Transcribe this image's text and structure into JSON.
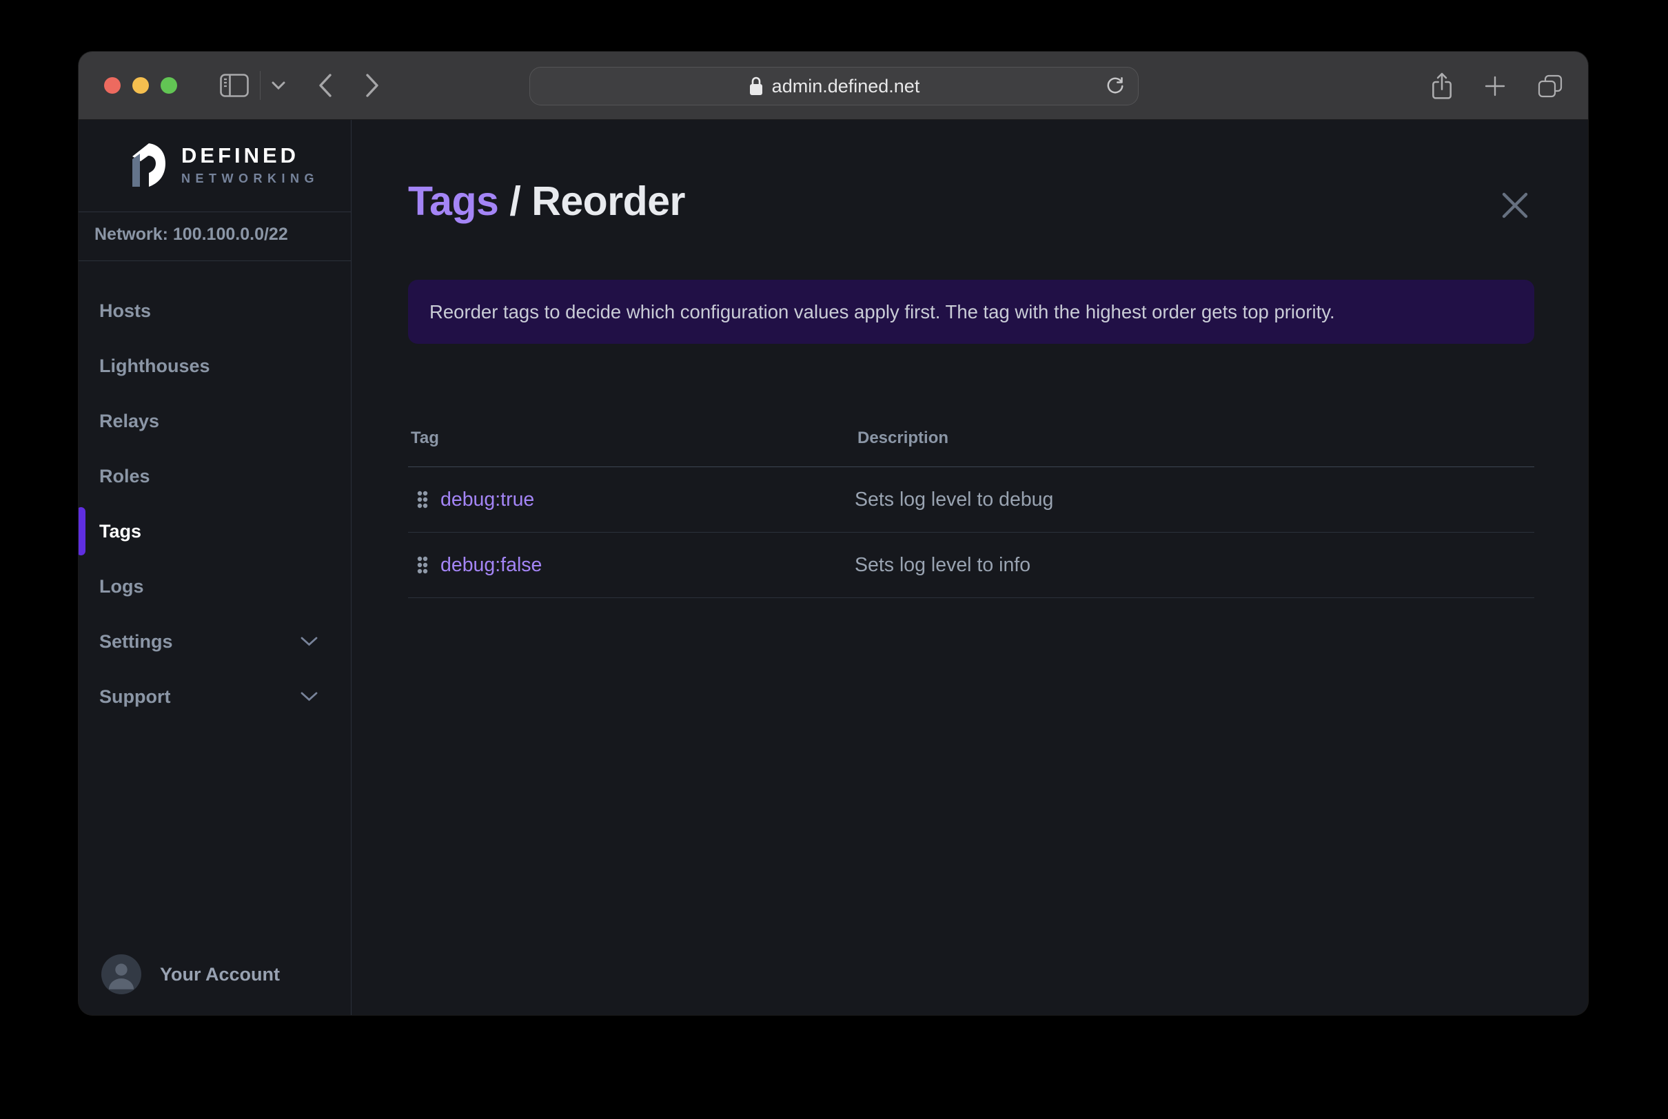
{
  "colors": {
    "accent": "#5f2ee0",
    "accentText": "#a485f6",
    "bannerBg": "#211046",
    "tlClose": "#ed6a5f",
    "tlMin": "#f5bf4f",
    "tlMax": "#62c554"
  },
  "browser": {
    "url": "admin.defined.net",
    "icons": [
      "sidebar-toggle-icon",
      "toolbar-chevron-down-icon",
      "back-icon",
      "forward-icon",
      "lock-icon",
      "reload-icon",
      "share-icon",
      "new-tab-icon",
      "tab-overview-icon"
    ]
  },
  "sidebar": {
    "logo": {
      "line1": "DEFINED",
      "line2": "NETWORKING"
    },
    "network_label": "Network: 100.100.0.0/22",
    "items": [
      {
        "label": "Hosts",
        "active": false,
        "chevron": false
      },
      {
        "label": "Lighthouses",
        "active": false,
        "chevron": false
      },
      {
        "label": "Relays",
        "active": false,
        "chevron": false
      },
      {
        "label": "Roles",
        "active": false,
        "chevron": false
      },
      {
        "label": "Tags",
        "active": true,
        "chevron": false
      },
      {
        "label": "Logs",
        "active": false,
        "chevron": false
      },
      {
        "label": "Settings",
        "active": false,
        "chevron": true
      },
      {
        "label": "Support",
        "active": false,
        "chevron": true
      }
    ],
    "account": {
      "label": "Your Account",
      "icon": "user-avatar-icon"
    }
  },
  "main": {
    "breadcrumb": {
      "section": "Tags",
      "separator": "/",
      "page": "Reorder"
    },
    "close_icon": "close-icon",
    "banner": "Reorder tags to decide which configuration values apply first. The tag with the highest order gets top priority.",
    "table": {
      "columns": [
        "Tag",
        "Description"
      ],
      "rows": [
        {
          "tag": "debug:true",
          "description": "Sets log level to debug",
          "icon": "drag-handle-icon"
        },
        {
          "tag": "debug:false",
          "description": "Sets log level to info",
          "icon": "drag-handle-icon"
        }
      ]
    }
  }
}
